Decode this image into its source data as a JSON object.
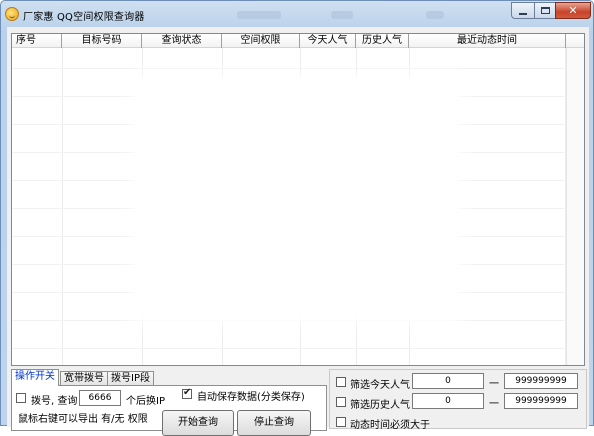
{
  "window": {
    "title": "厂家惠 QQ空间权限查询器",
    "controls": {
      "minimize": "minimize-icon",
      "maximize": "maximize-icon",
      "close": "close-icon"
    }
  },
  "list": {
    "columns": [
      "序号",
      "目标号码",
      "查询状态",
      "空间权限",
      "今天人气",
      "历史人气",
      "最近动态时间"
    ],
    "rows": []
  },
  "tabs": [
    {
      "label": "操作开关",
      "active": true
    },
    {
      "label": "宽带拨号",
      "active": false
    },
    {
      "label": "拨号IP段",
      "active": false
    }
  ],
  "options": {
    "dial_label": "拨号, 查询",
    "dial_checked": false,
    "dial_count": "6666",
    "dial_suffix": "个后换IP",
    "export_hint": "鼠标右键可以导出 有/无 权限",
    "autosave_label": "自动保存数据(分类保存)",
    "autosave_checked": true,
    "start_button": "开始查询",
    "stop_button": "停止查询"
  },
  "filters": {
    "today_label": "筛选今天人气",
    "today_checked": false,
    "today_min": "0",
    "today_max": "999999999",
    "history_label": "筛选历史人气",
    "history_checked": false,
    "history_min": "0",
    "history_max": "999999999",
    "dynamic_label": "动态时间必须大于",
    "dynamic_checked": false,
    "range_sep": "一"
  },
  "colors": {
    "accent": "#0033cc",
    "frame": "#b9d1ea",
    "close": "#c7432a"
  }
}
